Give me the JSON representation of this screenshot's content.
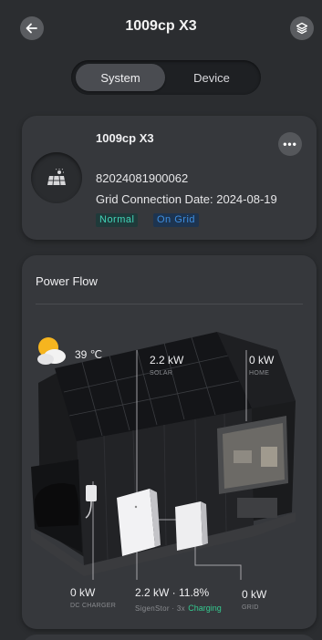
{
  "header": {
    "title": "1009cp X3",
    "back_icon": "arrow-left-icon",
    "layers_icon": "layers-icon"
  },
  "tabs": {
    "system": "System",
    "device": "Device",
    "active": "System"
  },
  "system_card": {
    "name": "1009cp X3",
    "serial": "82024081900062",
    "grid_connection_date": "Grid Connection Date: 2024-08-19",
    "status_badge": "Normal",
    "grid_badge": "On Grid",
    "more_label": "•••",
    "colors": {
      "normal": "#42d4b8",
      "on_grid": "#3e8ee0"
    }
  },
  "power_flow": {
    "title": "Power Flow",
    "weather": {
      "temperature": "39 ℃",
      "icon": "partly-cloudy-icon"
    },
    "solar": {
      "value": "2.2 kW",
      "label": "SOLAR"
    },
    "home": {
      "value": "0 kW",
      "label": "HOME"
    },
    "dc_charger": {
      "value": "0 kW",
      "label": "DC CHARGER"
    },
    "battery": {
      "value": "2.2 kW · 11.8%",
      "label": "SigenStor · 3x",
      "status": "Charging",
      "status_color": "#34c98f"
    },
    "grid": {
      "value": "0 kW",
      "label": "GRID"
    }
  }
}
